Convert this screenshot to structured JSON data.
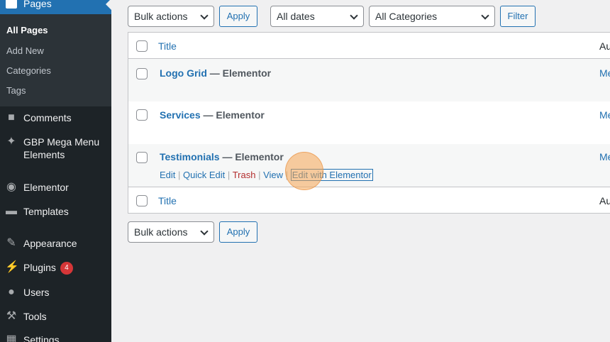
{
  "sidebar": {
    "current_menu": "Pages",
    "submenu": [
      "All Pages",
      "Add New",
      "Categories",
      "Tags"
    ],
    "items": [
      {
        "label": "Comments",
        "icon": "comment-icon"
      },
      {
        "label": "GBP Mega Menu Elements",
        "icon": "pin-icon"
      },
      {
        "label": "Elementor",
        "icon": "elementor-icon"
      },
      {
        "label": "Templates",
        "icon": "folder-icon"
      },
      {
        "label": "Appearance",
        "icon": "brush-icon"
      },
      {
        "label": "Plugins",
        "icon": "plugin-icon",
        "badge": "4"
      },
      {
        "label": "Users",
        "icon": "user-icon"
      },
      {
        "label": "Tools",
        "icon": "wrench-icon"
      },
      {
        "label": "Settings",
        "icon": "settings-icon"
      }
    ]
  },
  "toolbar_top": {
    "bulk_actions": "Bulk actions",
    "apply": "Apply",
    "dates": "All dates",
    "categories": "All Categories",
    "filter": "Filter"
  },
  "table": {
    "header_title": "Title",
    "header_author": "Au",
    "rows": [
      {
        "title": "Logo Grid",
        "state": "— Elementor",
        "author": "Me"
      },
      {
        "title": "Services",
        "state": "— Elementor",
        "author": "Me"
      },
      {
        "title": "Testimonials",
        "state": "— Elementor",
        "author": "Me"
      }
    ],
    "row_actions": {
      "edit": "Edit",
      "quick_edit": "Quick Edit",
      "trash": "Trash",
      "view": "View",
      "edit_elementor": "Edit with Elementor",
      "sep": "|"
    },
    "footer_title": "Title",
    "footer_author": "Au"
  },
  "toolbar_bottom": {
    "bulk_actions": "Bulk actions",
    "apply": "Apply"
  },
  "colors": {
    "sidebar_bg": "#1d2327",
    "accent": "#2271b1",
    "trash": "#b32d2e",
    "badge": "#d63638",
    "click_marker": "#f5a654"
  }
}
